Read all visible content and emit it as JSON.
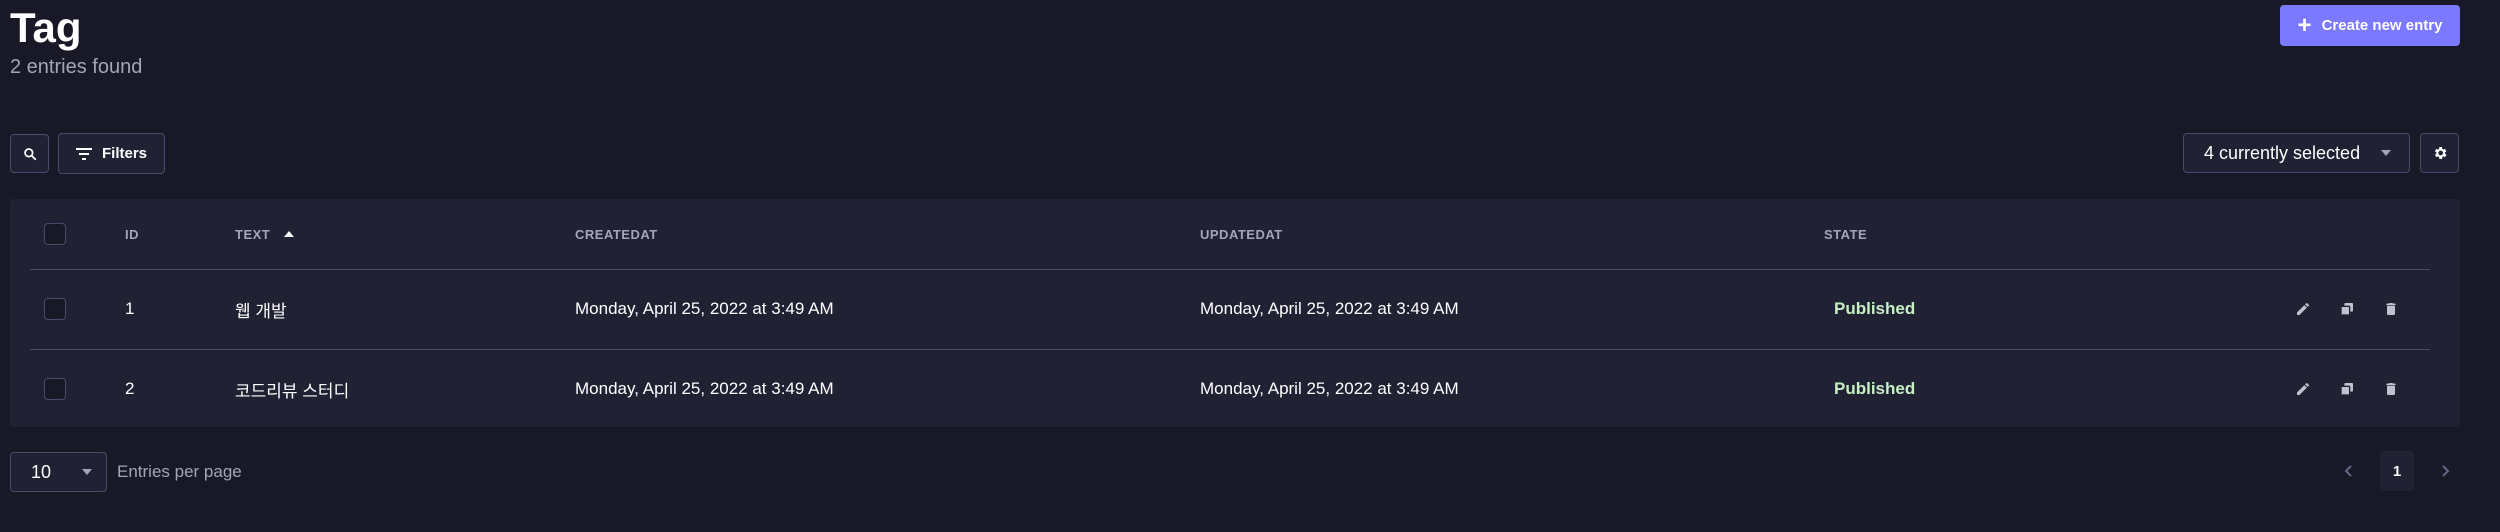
{
  "header": {
    "title": "Tag",
    "subtitle": "2 entries found",
    "create_button_label": "Create new entry"
  },
  "toolbar": {
    "filters_label": "Filters",
    "columns_select_value": "4 currently selected"
  },
  "table": {
    "columns": [
      "ID",
      "TEXT",
      "CREATEDAT",
      "UPDATEDAT",
      "STATE"
    ],
    "sort_column": "TEXT",
    "sort_direction": "ascending",
    "rows": [
      {
        "id": "1",
        "text": "웹 개발",
        "created_at": "Monday, April 25, 2022 at 3:49 AM",
        "updated_at": "Monday, April 25, 2022 at 3:49 AM",
        "state": "Published"
      },
      {
        "id": "2",
        "text": "코드리뷰 스터디",
        "created_at": "Monday, April 25, 2022 at 3:49 AM",
        "updated_at": "Monday, April 25, 2022 at 3:49 AM",
        "state": "Published"
      }
    ]
  },
  "footer": {
    "per_page_value": "10",
    "per_page_label": "Entries per page",
    "current_page": "1"
  },
  "colors": {
    "background": "#181826",
    "surface": "#212134",
    "border": "#4a4a6a",
    "accent": "#7b79ff",
    "muted_text": "#a5a5ba",
    "published": "#c6f0c2"
  },
  "icons": {
    "create": "plus-icon",
    "search": "search-icon",
    "filters": "filter-icon",
    "columns_dropdown": "caret-down-icon",
    "settings": "gear-icon",
    "sort": "sort-up-icon",
    "edit": "pencil-icon",
    "duplicate": "duplicate-icon",
    "delete": "trash-icon",
    "prev": "chevron-left-icon",
    "next": "chevron-right-icon"
  }
}
